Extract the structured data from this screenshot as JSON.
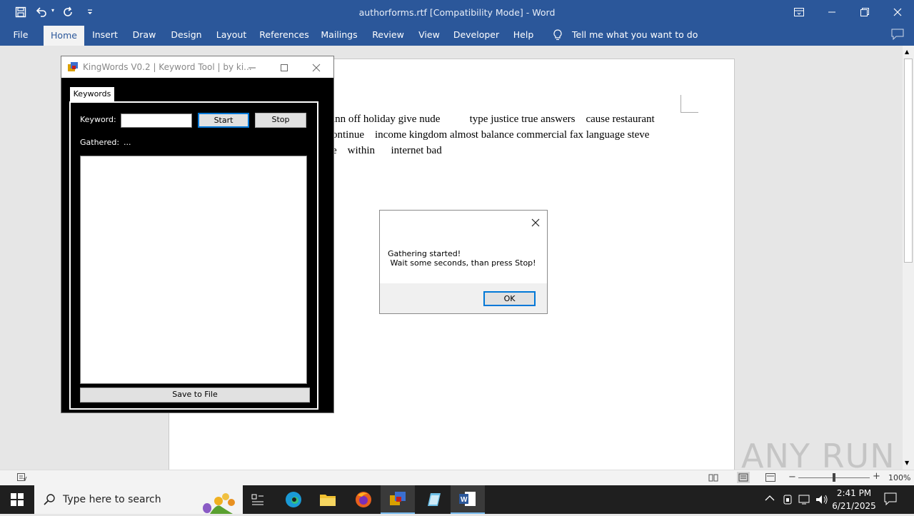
{
  "word": {
    "title": "authorforms.rtf [Compatibility Mode] - Word",
    "tabs": [
      "File",
      "Home",
      "Insert",
      "Draw",
      "Design",
      "Layout",
      "References",
      "Mailings",
      "Review",
      "View",
      "Developer",
      "Help"
    ],
    "tell_me": "Tell me what you want to do",
    "doc_lines": [
      "inn off holiday give nude           type justice true answers    cause restaurant",
      "ontinue    income kingdom almost balance commercial fax language steve",
      "e    within      internet bad"
    ],
    "zoom": "100%",
    "colors": {
      "accent": "#2b579a"
    }
  },
  "kingwords": {
    "title": "KingWords V0.2 | Keyword Tool | by ki...",
    "tab": "Keywords",
    "keyword_label": "Keyword:",
    "keyword_value": "",
    "start_label": "Start",
    "stop_label": "Stop",
    "gathered_label": "Gathered:",
    "gathered_value": "...",
    "save_label": "Save to File"
  },
  "dialog": {
    "line1": "Gathering started!",
    "line2": " Wait some seconds, than press Stop!",
    "ok_label": "OK"
  },
  "taskbar": {
    "search_placeholder": "Type here to search",
    "time": "2:41 PM",
    "date": "6/21/2025"
  },
  "watermark": "ANY RUN"
}
